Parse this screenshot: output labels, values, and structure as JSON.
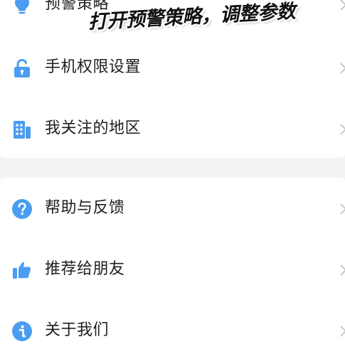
{
  "colors": {
    "icon_blue": "#4a9df0",
    "background": "#f2f3f5",
    "card": "#ffffff",
    "text": "#1f1f1f"
  },
  "caption": "打开预警策略，调整参数",
  "menu": {
    "group1": [
      {
        "label": "预警策略",
        "icon": "lightbulb-icon"
      },
      {
        "label": "手机权限设置",
        "icon": "lock-icon"
      },
      {
        "label": "我关注的地区",
        "icon": "building-icon"
      }
    ],
    "group2": [
      {
        "label": "帮助与反馈",
        "icon": "question-icon"
      },
      {
        "label": "推荐给朋友",
        "icon": "thumbs-up-icon"
      },
      {
        "label": "关于我们",
        "icon": "info-icon"
      }
    ]
  }
}
